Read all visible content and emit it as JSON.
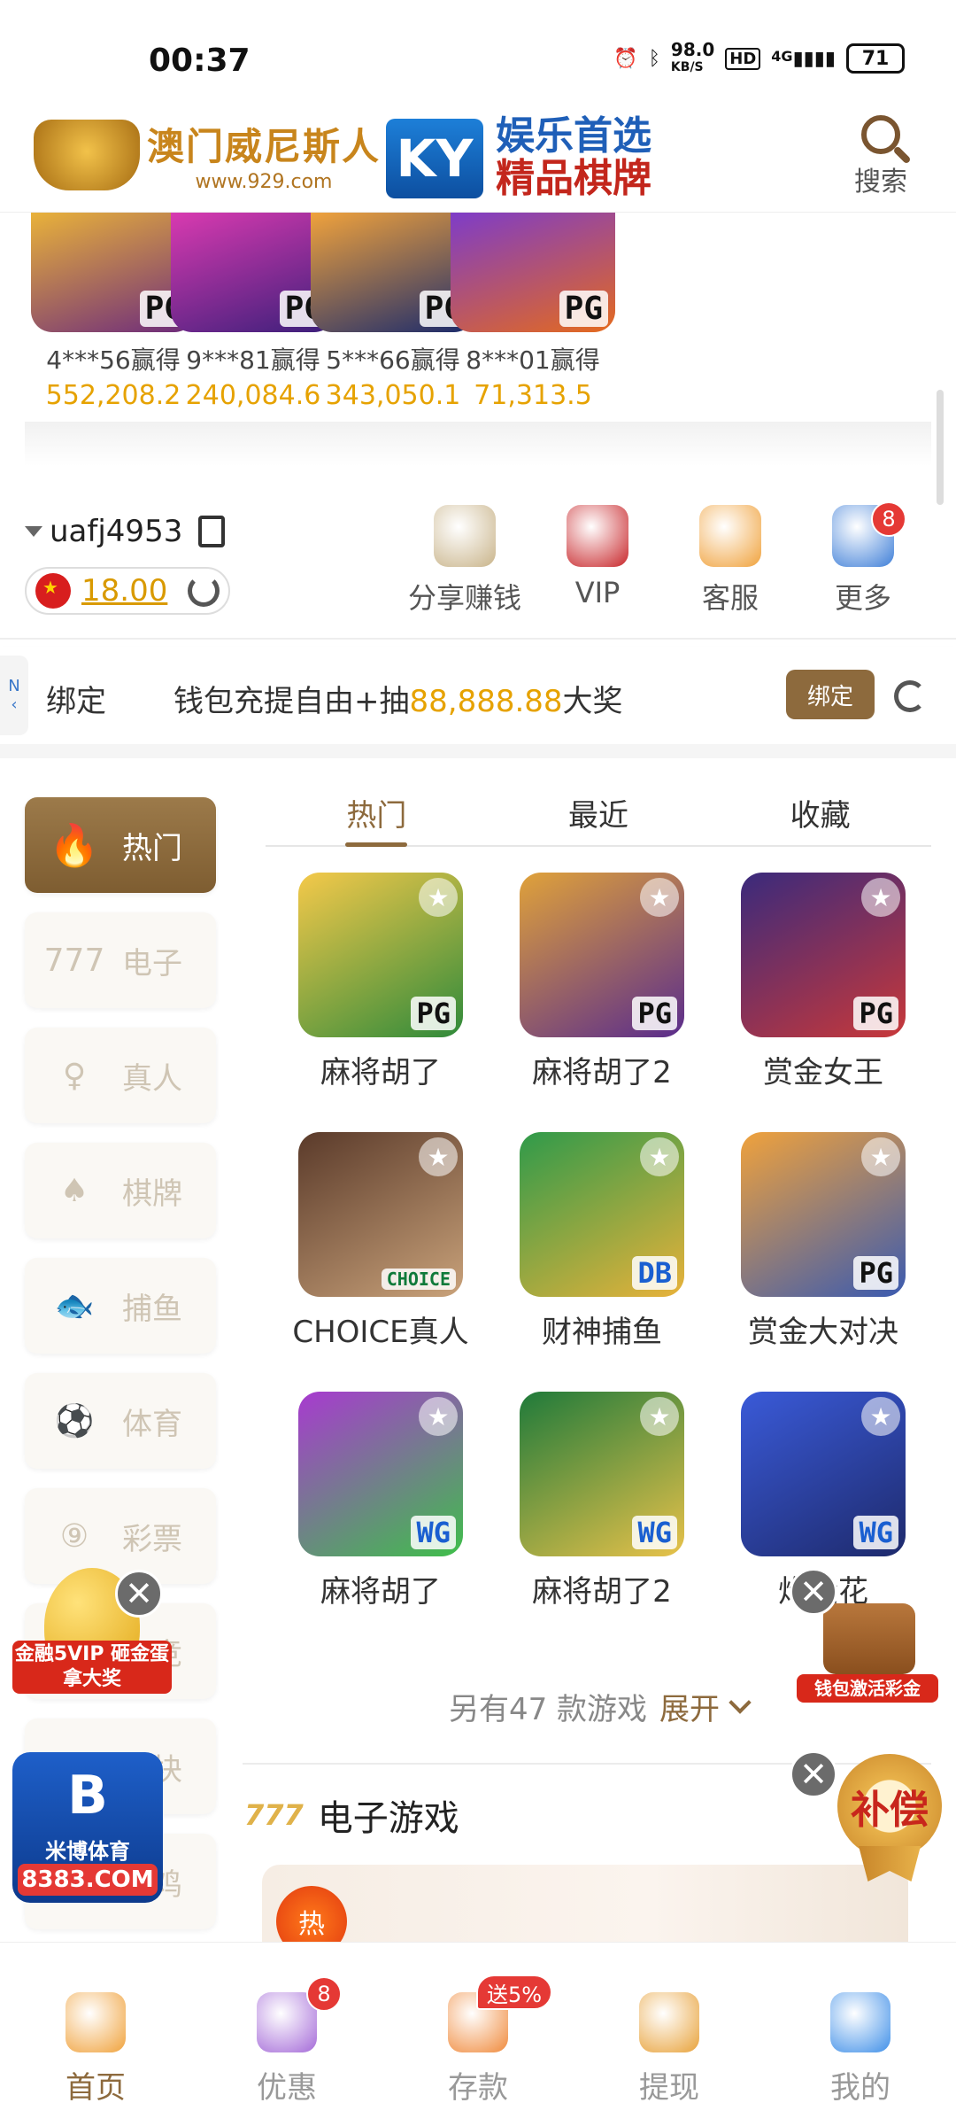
{
  "status_bar": {
    "time": "00:37",
    "net_speed": "98.0",
    "net_unit": "KB/S",
    "hd_label": "HD",
    "signal_label": "4G",
    "battery": "71"
  },
  "header": {
    "logo1_main": "澳门威尼斯人",
    "logo1_sub": "www.929.com",
    "ky_badge": "KY",
    "ky_line1": "娱乐首选",
    "ky_line2": "精品棋牌",
    "search_label": "搜索"
  },
  "winners": [
    {
      "user": "4***56赢得",
      "amount": "552,208.2",
      "tag": "PG",
      "colors": [
        "#e9b23a",
        "#6c2a7c"
      ]
    },
    {
      "user": "9***81赢得",
      "amount": "240,084.6",
      "tag": "PG",
      "colors": [
        "#d93ab0",
        "#3b1f7a"
      ]
    },
    {
      "user": "5***66赢得",
      "amount": "343,050.1",
      "tag": "PG",
      "colors": [
        "#f0a23c",
        "#1a2a6c"
      ]
    },
    {
      "user": "8***01赢得",
      "amount": "71,313.5",
      "tag": "PG",
      "colors": [
        "#7e3cc8",
        "#e46a1e"
      ]
    }
  ],
  "account": {
    "username": "uafj4953",
    "balance": "18.00"
  },
  "quick_actions": [
    {
      "label": "分享赚钱",
      "icon": "money-bag-icon",
      "color": "#c9b48a"
    },
    {
      "label": "VIP",
      "icon": "vip-diamond-icon",
      "color": "#c8262a"
    },
    {
      "label": "客服",
      "icon": "customer-service-icon",
      "color": "#f0a23c"
    },
    {
      "label": "更多",
      "icon": "more-grid-icon",
      "color": "#3f7fd8",
      "badge": "8"
    }
  ],
  "bind_bar": {
    "side_tab": "N",
    "label": "绑定",
    "promo_prefix": "钱包充提自由+抽",
    "promo_amount": "88,888.88",
    "promo_suffix": "大奖",
    "button": "绑定"
  },
  "side_nav": [
    {
      "label": "热门",
      "icon": "flame-icon",
      "glyph": "🔥",
      "active": true
    },
    {
      "label": "电子",
      "icon": "slot-777-icon",
      "glyph": "777"
    },
    {
      "label": "真人",
      "icon": "live-dealer-icon",
      "glyph": "♀"
    },
    {
      "label": "棋牌",
      "icon": "cards-icon",
      "glyph": "♠"
    },
    {
      "label": "捕鱼",
      "icon": "fish-icon",
      "glyph": "🐟"
    },
    {
      "label": "体育",
      "icon": "soccer-ball-icon",
      "glyph": "⚽"
    },
    {
      "label": "彩票",
      "icon": "lottery-icon",
      "glyph": "⑨"
    },
    {
      "label": "电竞",
      "icon": "esports-icon",
      "glyph": "🎮"
    },
    {
      "label": "区块",
      "icon": "blockchain-icon",
      "glyph": "⬡"
    },
    {
      "label": "斗鸡",
      "icon": "cockfight-icon",
      "glyph": "🐓"
    }
  ],
  "tabs": [
    "热门",
    "最近",
    "收藏"
  ],
  "games": [
    [
      {
        "name": "麻将胡了",
        "tag": "PG",
        "tag_type": "pg",
        "colors": [
          "#f5c94a",
          "#2f8a3a"
        ]
      },
      {
        "name": "麻将胡了2",
        "tag": "PG",
        "tag_type": "pg",
        "colors": [
          "#e0a23a",
          "#5a2c8c"
        ]
      },
      {
        "name": "赏金女王",
        "tag": "PG",
        "tag_type": "pg",
        "colors": [
          "#3a2a7c",
          "#c8383a"
        ]
      }
    ],
    [
      {
        "name": "CHOICE真人",
        "tag": "CHOICE",
        "tag_type": "choice",
        "colors": [
          "#5a3a2a",
          "#c9a27a"
        ]
      },
      {
        "name": "财神捕鱼",
        "tag": "DB",
        "tag_type": "db",
        "colors": [
          "#2f9a4a",
          "#e8b23a"
        ]
      },
      {
        "name": "赏金大对决",
        "tag": "PG",
        "tag_type": "pg",
        "colors": [
          "#f0a23c",
          "#3a5ab0"
        ]
      }
    ],
    [
      {
        "name": "麻将胡了",
        "tag": "WG",
        "tag_type": "wg",
        "colors": [
          "#a83ad0",
          "#3fbf4a"
        ]
      },
      {
        "name": "麻将胡了2",
        "tag": "WG",
        "tag_type": "wg",
        "colors": [
          "#1f7a3a",
          "#e8c24a"
        ]
      },
      {
        "name": "炸金花",
        "tag": "WG",
        "tag_type": "wg",
        "colors": [
          "#3a5ad8",
          "#1e2a6c"
        ]
      }
    ]
  ],
  "more_games": {
    "text": "另有47 款游戏",
    "expand": "展开"
  },
  "section": {
    "icon_text": "777",
    "title": "电子游戏",
    "banner_hot": "热"
  },
  "floats": {
    "egg_text": "金融5VIP 砸金蛋拿大奖",
    "mibo_mark": "B",
    "mibo_name": "米博体育",
    "mibo_domain": "8383.COM",
    "wallet_text": "钱包激活彩金",
    "comp_text": "补偿",
    "close": "✕"
  },
  "bottom_nav": [
    {
      "label": "首页",
      "icon": "home-icon",
      "color": "#f0a23c",
      "active": true
    },
    {
      "label": "优惠",
      "icon": "gift-icon",
      "color": "#a46ad8",
      "badge": "8"
    },
    {
      "label": "存款",
      "icon": "deposit-wallet-icon",
      "color": "#f08a3c",
      "badge_wide": "送5%"
    },
    {
      "label": "提现",
      "icon": "withdraw-icon",
      "color": "#e8a23a"
    },
    {
      "label": "我的",
      "icon": "profile-icon",
      "color": "#3f8fe8"
    }
  ]
}
